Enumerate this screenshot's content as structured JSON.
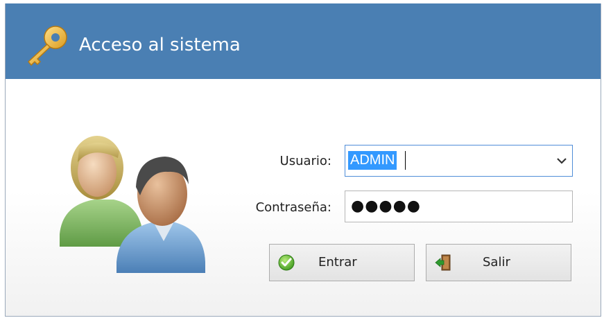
{
  "window": {
    "title": "Acceso al sistema",
    "header_color": "#4a7fb3",
    "key_icon": "key-icon",
    "users_icon": "users-icon"
  },
  "form": {
    "user_label": "Usuario:",
    "user_value": "ADMIN",
    "password_label": "Contraseña:",
    "password_value": "●●●●●"
  },
  "buttons": {
    "enter_label": "Entrar",
    "enter_icon": "check-icon",
    "exit_label": "Salir",
    "exit_icon": "exit-door-icon"
  }
}
